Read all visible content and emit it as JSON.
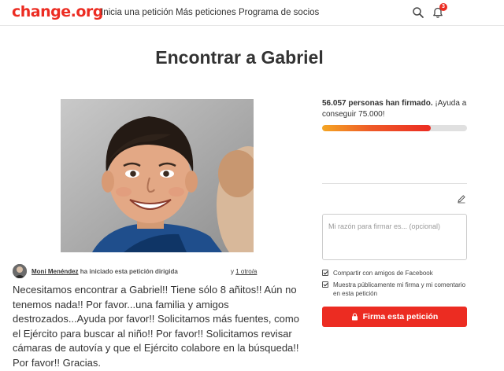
{
  "nav": {
    "logo": "change.org",
    "links": [
      "Inicia una petición",
      "Más peticiones",
      "Programa de socios"
    ],
    "notification_count": "3",
    "icons": [
      "search-icon",
      "bell-icon"
    ]
  },
  "petition": {
    "title": "Encontrar a Gabriel",
    "author_name": "Moni Menéndez",
    "author_action": "ha iniciado esta petición dirigida",
    "recipients_link": "1 otro/a",
    "recipients_prefix": "y",
    "description": "Necesitamos encontrar a Gabriel!! Tiene sólo 8 añitos!! Aún no tenemos nada!! Por favor...una familia y amigos destrozados...Ayuda por favor!! Solicitamos más fuentes, como el Ejército para buscar al niño!! Por favor!! Solicitamos revisar cámaras de autovía y que el Ejército colabore en la búsqueda!! Por favor!! Gracias."
  },
  "signatures": {
    "count_text": "56.057 personas han firmado.",
    "goal_text": "¡Ayuda a conseguir 75.000!",
    "signed": 56057,
    "goal": 75000
  },
  "form": {
    "reason_placeholder": "Mi razón para firmar es... (opcional)",
    "share_facebook_label": "Compartir con amigos de Facebook",
    "share_facebook_checked": true,
    "public_label": "Muestra públicamente mi firma y mi comentario en esta petición",
    "public_checked": true,
    "sign_button": "Firma esta petición"
  },
  "colors": {
    "brand": "#ec2c22",
    "progress_start": "#f5a623",
    "progress_end": "#ec2c22"
  }
}
